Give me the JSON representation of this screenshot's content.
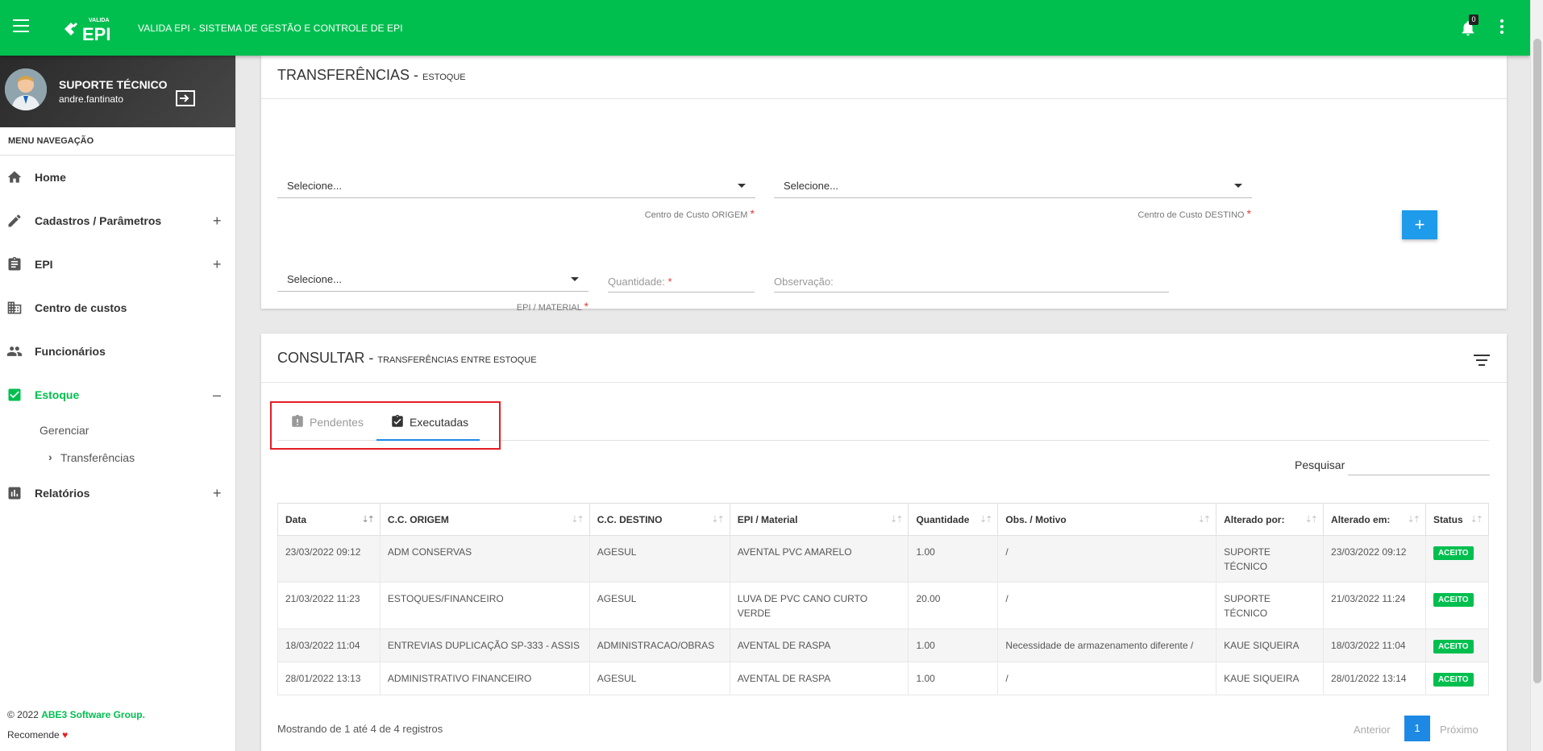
{
  "app": {
    "logo_small": "VALIDA",
    "logo_big": "EPI",
    "title": "VALIDA EPI - SISTEMA DE GESTÃO E CONTROLE DE EPI",
    "notification_count": "0"
  },
  "user": {
    "name": "SUPORTE TÉCNICO",
    "login": "andre.fantinato"
  },
  "sidebar": {
    "header": "MENU NAVEGAÇÃO",
    "items": [
      {
        "label": "Home",
        "icon": "home-icon",
        "expand": ""
      },
      {
        "label": "Cadastros / Parâmetros",
        "icon": "pencil-icon",
        "expand": "+"
      },
      {
        "label": "EPI",
        "icon": "clipboard-icon",
        "expand": "+"
      },
      {
        "label": "Centro de custos",
        "icon": "building-icon",
        "expand": ""
      },
      {
        "label": "Funcionários",
        "icon": "people-icon",
        "expand": ""
      },
      {
        "label": "Estoque",
        "icon": "checkbox-icon",
        "expand": "–"
      },
      {
        "label": "Relatórios",
        "icon": "bar-chart-icon",
        "expand": "+"
      }
    ],
    "sub": {
      "gerenciar": "Gerenciar",
      "transferencias": "Transferências"
    },
    "footer": {
      "copyright": "© 2022",
      "company": "ABE3 Software Group.",
      "recommend": "Recomende"
    }
  },
  "form": {
    "title": "TRANSFERÊNCIAS - ",
    "subtitle": "ESTOQUE",
    "origem_value": "Selecione...",
    "origem_hint": "Centro de Custo ORIGEM",
    "destino_value": "Selecione...",
    "destino_hint": "Centro de Custo DESTINO",
    "epi_value": "Selecione...",
    "epi_hint": "EPI / MATERIAL",
    "quantidade_label": "Quantidade:",
    "observacao_label": "Observação:",
    "required_mark": "*",
    "add_label": "+"
  },
  "consult": {
    "title": "CONSULTAR - ",
    "subtitle": "TRANSFERÊNCIAS ENTRE ESTOQUE",
    "tabs": {
      "pendentes": "Pendentes",
      "executadas": "Executadas"
    },
    "search_label": "Pesquisar",
    "columns": [
      "Data",
      "C.C. ORIGEM",
      "C.C. DESTINO",
      "EPI / Material",
      "Quantidade",
      "Obs. / Motivo",
      "Alterado por:",
      "Alterado em:",
      "Status"
    ],
    "rows": [
      [
        "23/03/2022 09:12",
        "ADM CONSERVAS",
        "AGESUL",
        "AVENTAL PVC AMARELO",
        "1.00",
        "/",
        "SUPORTE TÉCNICO",
        "23/03/2022 09:12",
        "ACEITO"
      ],
      [
        "21/03/2022 11:23",
        "ESTOQUES/FINANCEIRO",
        "AGESUL",
        "LUVA DE PVC CANO CURTO VERDE",
        "20.00",
        "/",
        "SUPORTE TÉCNICO",
        "21/03/2022 11:24",
        "ACEITO"
      ],
      [
        "18/03/2022 11:04",
        "ENTREVIAS DUPLICAÇÃO SP-333 - ASSIS",
        "ADMINISTRACAO/OBRAS",
        "AVENTAL DE RASPA",
        "1.00",
        "Necessidade de armazenamento diferente /",
        "KAUE SIQUEIRA",
        "18/03/2022 11:04",
        "ACEITO"
      ],
      [
        "28/01/2022 13:13",
        "ADMINISTRATIVO FINANCEIRO",
        "AGESUL",
        "AVENTAL DE RASPA",
        "1.00",
        "/",
        "KAUE SIQUEIRA",
        "28/01/2022 13:14",
        "ACEITO"
      ]
    ],
    "showing": "Mostrando de 1 até 4 de 4 registros",
    "pager": {
      "prev": "Anterior",
      "current": "1",
      "next": "Próximo"
    }
  },
  "colors": {
    "primary": "#00bf4f",
    "accent": "#1e88e5",
    "highlight": "#e31e24"
  }
}
